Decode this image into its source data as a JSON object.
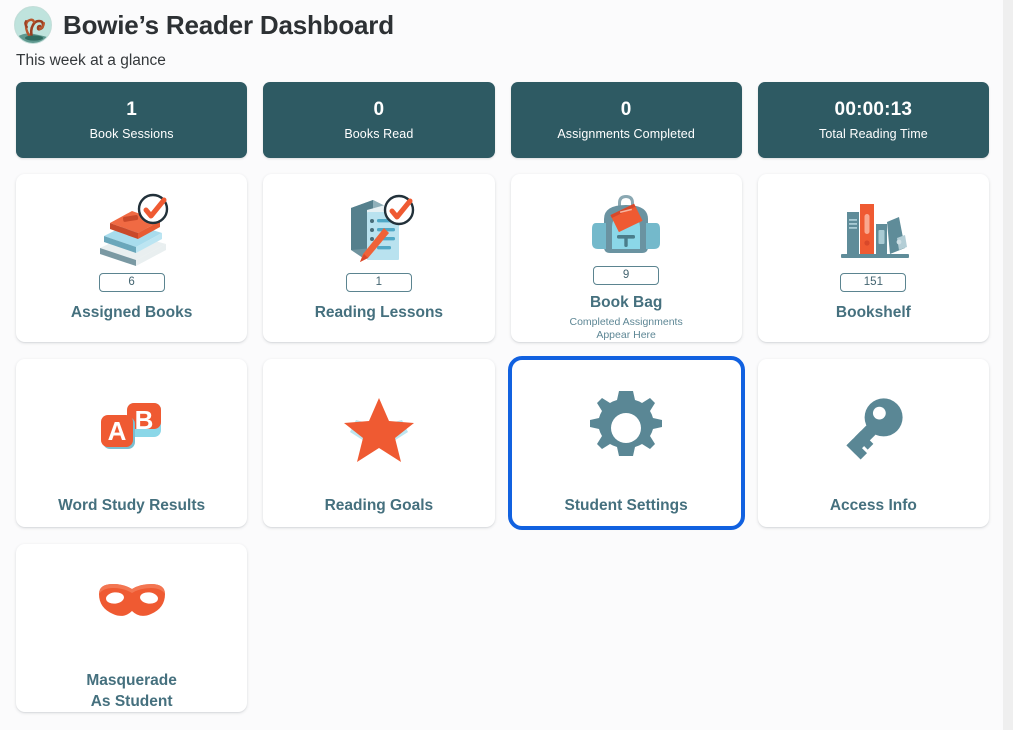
{
  "header": {
    "logo_icon": "tree-squirrel-logo",
    "title": "Bowie’s Reader Dashboard",
    "subtitle": "This week at a glance"
  },
  "stats": [
    {
      "value": "1",
      "label": "Book Sessions",
      "name": "book-sessions"
    },
    {
      "value": "0",
      "label": "Books Read",
      "name": "books-read"
    },
    {
      "value": "0",
      "label": "Assignments Completed",
      "name": "assignments-completed"
    },
    {
      "value": "00:00:13",
      "label": "Total Reading Time",
      "name": "total-reading-time"
    }
  ],
  "tiles": [
    {
      "label": "Assigned Books",
      "count": "6",
      "icon": "stacked-books-check-icon",
      "sub": ""
    },
    {
      "label": "Reading Lessons",
      "count": "1",
      "icon": "lesson-checklist-pencil-icon",
      "sub": ""
    },
    {
      "label": "Book Bag",
      "count": "9",
      "icon": "backpack-icon",
      "sub": "Completed Assignments\nAppear Here"
    },
    {
      "label": "Bookshelf",
      "count": "151",
      "icon": "bookshelf-icon",
      "sub": ""
    },
    {
      "label": "Word Study Results",
      "count": "",
      "icon": "ab-blocks-icon",
      "sub": ""
    },
    {
      "label": "Reading Goals",
      "count": "",
      "icon": "star-icon",
      "sub": ""
    },
    {
      "label": "Student Settings",
      "count": "",
      "icon": "gear-icon",
      "sub": ""
    },
    {
      "label": "Access Info",
      "count": "",
      "icon": "key-icon",
      "sub": ""
    },
    {
      "label": "Masquerade\nAs Student",
      "count": "",
      "icon": "mask-icon",
      "sub": ""
    }
  ],
  "focused_tile_label": "Student Settings",
  "colors": {
    "stat_card_bg": "#2e5a63",
    "tile_label": "#45707e",
    "accent_orange": "#ec5b33",
    "accent_teal": "#5b8a97",
    "accent_light_blue": "#86d4e3",
    "focus_ring": "#1161e0",
    "page_bg": "#fbfbfc"
  }
}
